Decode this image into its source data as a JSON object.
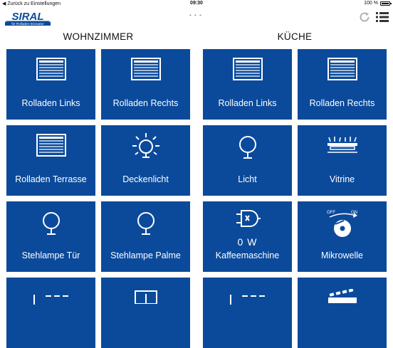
{
  "status": {
    "back": "◀ Zurück zu Einstellungen",
    "time": "09:30",
    "battery": "100 %",
    "battery_level": 1.0
  },
  "header": {
    "logo_main": "SIRAL",
    "logo_sub": "für Rolladen-Innovator",
    "page_dots": "• • •",
    "refresh_icon": "refresh-icon",
    "menu_icon": "list-menu-icon"
  },
  "columns": [
    {
      "title": "WOHNZIMMER",
      "tiles": [
        {
          "label": "Rolladen Links",
          "icon": "shutter-icon"
        },
        {
          "label": "Rolladen Rechts",
          "icon": "shutter-icon"
        },
        {
          "label": "Rolladen Terrasse",
          "icon": "shutter-icon"
        },
        {
          "label": "Deckenlicht",
          "icon": "bulb-on-icon"
        },
        {
          "label": "Stehlampe Tür",
          "icon": "bulb-icon"
        },
        {
          "label": "Stehlampe Palme",
          "icon": "bulb-icon"
        }
      ]
    },
    {
      "title": "KÜCHE",
      "tiles": [
        {
          "label": "Rolladen Links",
          "icon": "shutter-icon"
        },
        {
          "label": "Rolladen Rechts",
          "icon": "shutter-icon"
        },
        {
          "label": "Licht",
          "icon": "bulb-icon"
        },
        {
          "label": "Vitrine",
          "icon": "cabinet-light-icon"
        },
        {
          "label": "Kaffeemaschine",
          "icon": "plug-icon",
          "value": "0 W"
        },
        {
          "label": "Mikrowelle",
          "icon": "dial-switch-icon",
          "off": "OFF",
          "on": "ON"
        }
      ]
    }
  ],
  "colors": {
    "tile": "#0b4a9b",
    "brand": "#0b4a9b"
  }
}
